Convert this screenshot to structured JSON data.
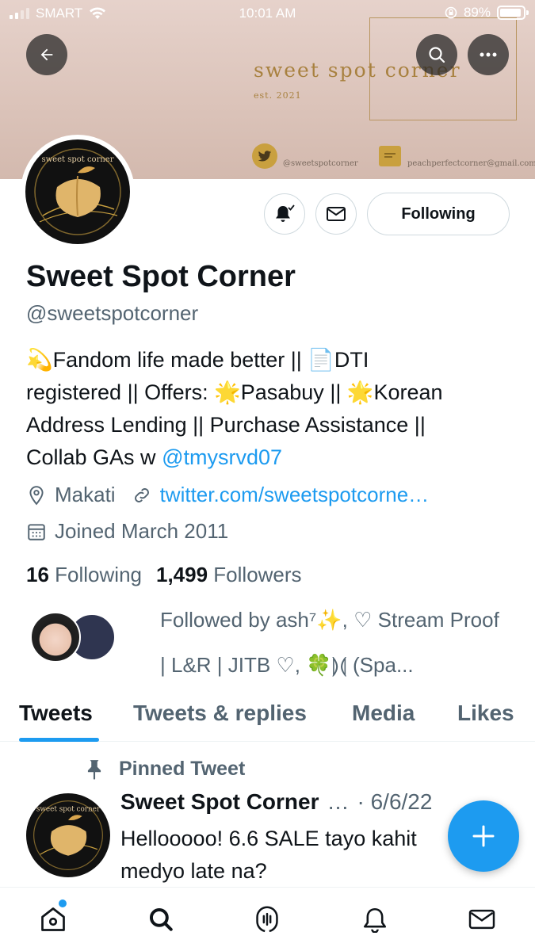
{
  "status_bar": {
    "carrier": "SMART",
    "time": "10:01 AM",
    "battery": "89%"
  },
  "banner": {
    "brand": "sweet spot corner",
    "est": "est. 2021",
    "twitter": "@sweetspotcorner",
    "email": "peachperfectcorner@gmail.com"
  },
  "profile": {
    "name": "Sweet Spot Corner",
    "handle": "@sweetspotcorner",
    "bio_line1": "💫Fandom life made better || 📄DTI",
    "bio_line2": "registered || Offers: 🌟Pasabuy || 🌟Korean",
    "bio_line3": "Address Lending || Purchase Assistance ||",
    "bio_line4_prefix": "Collab GAs w ",
    "bio_mention": "@tmysrvd07",
    "location": "Makati",
    "website": "twitter.com/sweetspotcorne…",
    "joined": "Joined March 2011",
    "following_count": "16",
    "following_label": "Following",
    "followers_count": "1,499",
    "followers_label": "Followers",
    "followed_by": "Followed by ash⁷✨, ♡ Stream Proof | L&R | JITB ♡, 🍀⟭⟬ (Spa..."
  },
  "actions": {
    "follow_label": "Following"
  },
  "tabs": [
    "Tweets",
    "Tweets & replies",
    "Media",
    "Likes"
  ],
  "pinned_tweet": {
    "label": "Pinned Tweet",
    "author": "Sweet Spot Corner",
    "ellipsis": "…",
    "date": "· 6/6/22",
    "text": "Hellooooo! 6.6 SALE tayo kahit medyo late na?"
  },
  "colors": {
    "accent": "#1d9bf0",
    "gold": "#c9a03f"
  }
}
